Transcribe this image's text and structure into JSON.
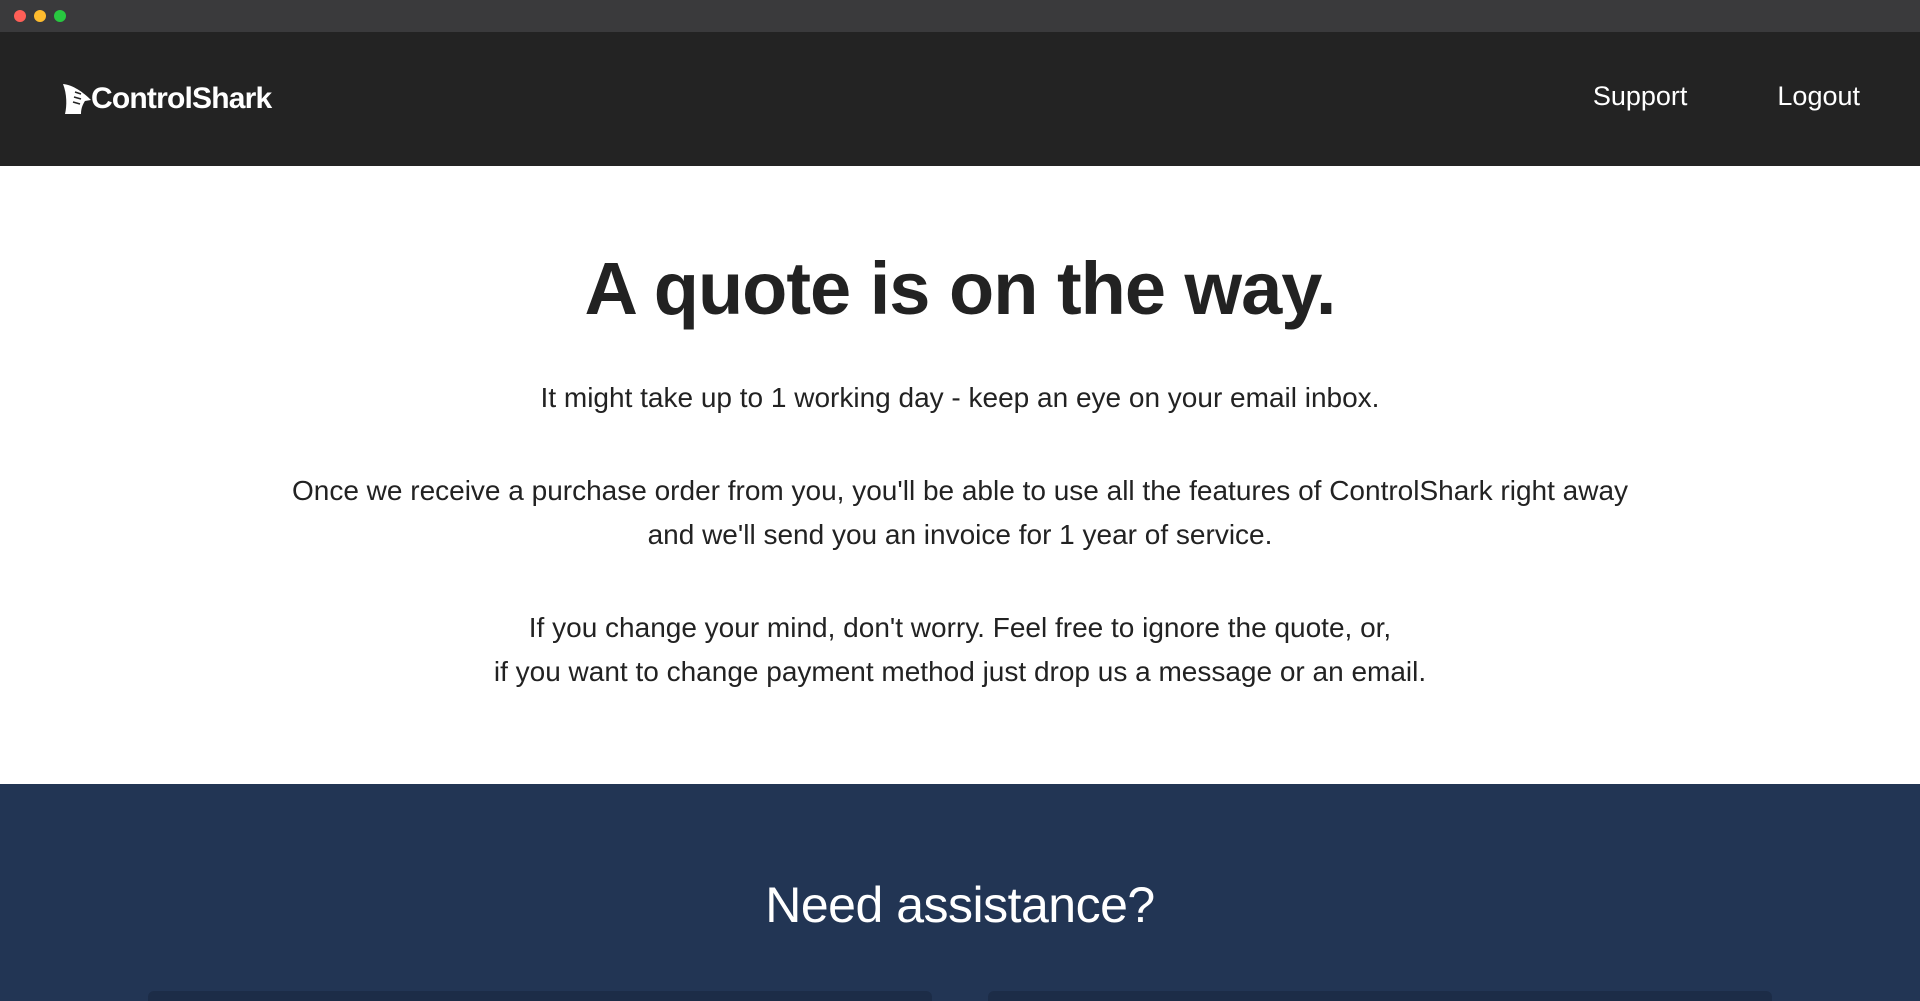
{
  "window": {
    "controls": [
      "close",
      "minimize",
      "maximize"
    ]
  },
  "header": {
    "logo_text": "ControlShark",
    "logo_icon": "shark-fin-icon",
    "nav": {
      "support_label": "Support",
      "logout_label": "Logout"
    }
  },
  "main": {
    "title": "A quote is on the way.",
    "paragraph1": "It might take up to 1 working day - keep an eye on your email inbox.",
    "paragraph2_line1": "Once we receive a purchase order from you, you'll be able to use all the features of ControlShark right away",
    "paragraph2_line2": "and we'll send you an invoice for 1 year of service.",
    "paragraph3_line1": "If you change your mind, don't worry. Feel free to ignore the quote, or,",
    "paragraph3_line2": "if you want to change payment method just drop us a message or an email."
  },
  "assistance": {
    "title": "Need assistance?"
  },
  "colors": {
    "header_bg": "#232323",
    "assist_bg": "#223554",
    "text_dark": "#222222",
    "text_light": "#ffffff"
  }
}
